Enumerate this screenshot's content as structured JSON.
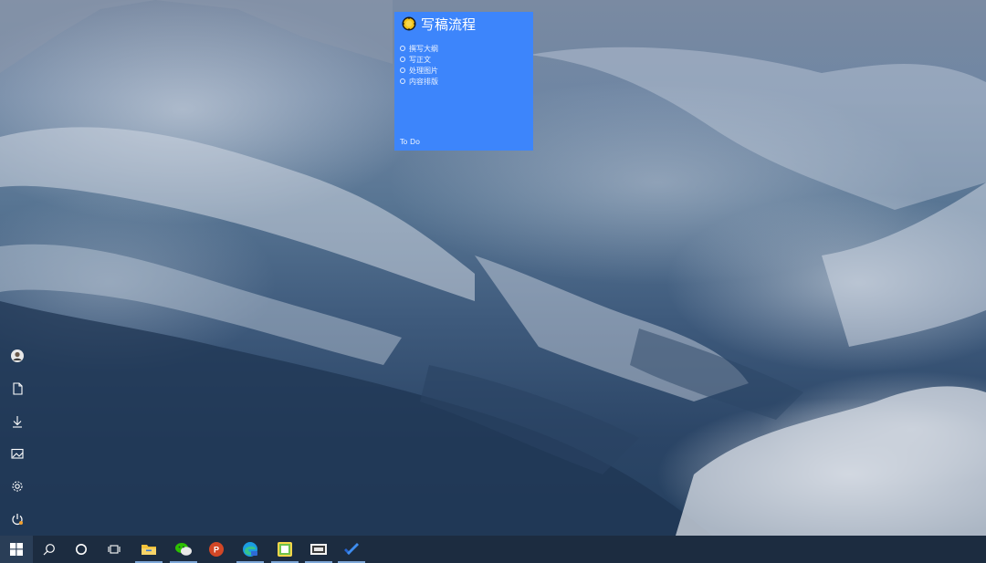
{
  "note": {
    "title": "写稿流程",
    "items": [
      {
        "text": "撰写大纲"
      },
      {
        "text": "写正文"
      },
      {
        "text": "处理图片"
      },
      {
        "text": "内容排版"
      }
    ],
    "footer": "To Do",
    "color": "#3d85fb",
    "icon": "sun-icon"
  },
  "start_rail": [
    {
      "name": "user-avatar-icon"
    },
    {
      "name": "documents-icon"
    },
    {
      "name": "downloads-icon"
    },
    {
      "name": "pictures-icon"
    },
    {
      "name": "settings-gear-icon"
    },
    {
      "name": "power-icon"
    }
  ],
  "taskbar": {
    "color": "#1c2c40",
    "items": [
      {
        "name": "start-windows-icon",
        "running": false
      },
      {
        "name": "search-icon",
        "running": false
      },
      {
        "name": "cortana-circle-icon",
        "running": false
      },
      {
        "name": "task-view-icon",
        "running": false
      },
      {
        "name": "file-explorer-icon",
        "running": true
      },
      {
        "name": "wechat-icon",
        "running": true
      },
      {
        "name": "powerpoint-icon",
        "running": false
      },
      {
        "name": "edge-browser-icon",
        "running": true
      },
      {
        "name": "notes-app-icon",
        "running": true
      },
      {
        "name": "screenshot-app-icon",
        "running": true
      },
      {
        "name": "microsoft-todo-icon",
        "running": true
      }
    ]
  }
}
